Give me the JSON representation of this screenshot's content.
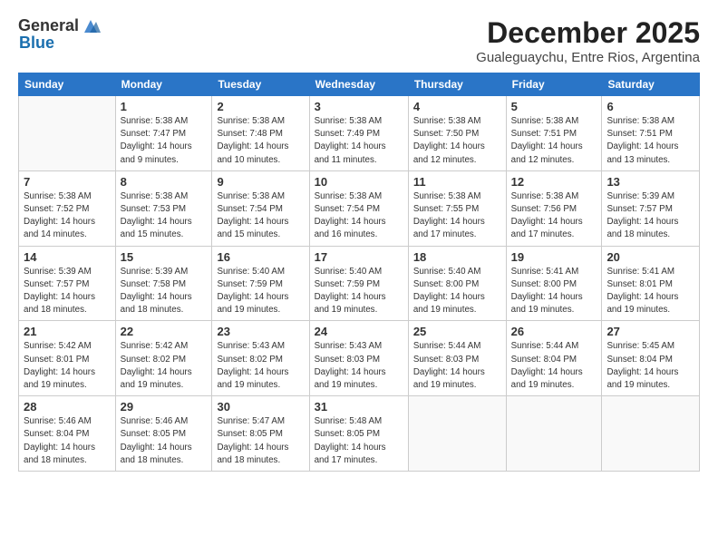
{
  "logo": {
    "general": "General",
    "blue": "Blue"
  },
  "header": {
    "title": "December 2025",
    "subtitle": "Gualeguaychu, Entre Rios, Argentina"
  },
  "weekdays": [
    "Sunday",
    "Monday",
    "Tuesday",
    "Wednesday",
    "Thursday",
    "Friday",
    "Saturday"
  ],
  "weeks": [
    [
      {
        "day": "",
        "info": ""
      },
      {
        "day": "1",
        "info": "Sunrise: 5:38 AM\nSunset: 7:47 PM\nDaylight: 14 hours\nand 9 minutes."
      },
      {
        "day": "2",
        "info": "Sunrise: 5:38 AM\nSunset: 7:48 PM\nDaylight: 14 hours\nand 10 minutes."
      },
      {
        "day": "3",
        "info": "Sunrise: 5:38 AM\nSunset: 7:49 PM\nDaylight: 14 hours\nand 11 minutes."
      },
      {
        "day": "4",
        "info": "Sunrise: 5:38 AM\nSunset: 7:50 PM\nDaylight: 14 hours\nand 12 minutes."
      },
      {
        "day": "5",
        "info": "Sunrise: 5:38 AM\nSunset: 7:51 PM\nDaylight: 14 hours\nand 12 minutes."
      },
      {
        "day": "6",
        "info": "Sunrise: 5:38 AM\nSunset: 7:51 PM\nDaylight: 14 hours\nand 13 minutes."
      }
    ],
    [
      {
        "day": "7",
        "info": "Sunrise: 5:38 AM\nSunset: 7:52 PM\nDaylight: 14 hours\nand 14 minutes."
      },
      {
        "day": "8",
        "info": "Sunrise: 5:38 AM\nSunset: 7:53 PM\nDaylight: 14 hours\nand 15 minutes."
      },
      {
        "day": "9",
        "info": "Sunrise: 5:38 AM\nSunset: 7:54 PM\nDaylight: 14 hours\nand 15 minutes."
      },
      {
        "day": "10",
        "info": "Sunrise: 5:38 AM\nSunset: 7:54 PM\nDaylight: 14 hours\nand 16 minutes."
      },
      {
        "day": "11",
        "info": "Sunrise: 5:38 AM\nSunset: 7:55 PM\nDaylight: 14 hours\nand 17 minutes."
      },
      {
        "day": "12",
        "info": "Sunrise: 5:38 AM\nSunset: 7:56 PM\nDaylight: 14 hours\nand 17 minutes."
      },
      {
        "day": "13",
        "info": "Sunrise: 5:39 AM\nSunset: 7:57 PM\nDaylight: 14 hours\nand 18 minutes."
      }
    ],
    [
      {
        "day": "14",
        "info": "Sunrise: 5:39 AM\nSunset: 7:57 PM\nDaylight: 14 hours\nand 18 minutes."
      },
      {
        "day": "15",
        "info": "Sunrise: 5:39 AM\nSunset: 7:58 PM\nDaylight: 14 hours\nand 18 minutes."
      },
      {
        "day": "16",
        "info": "Sunrise: 5:40 AM\nSunset: 7:59 PM\nDaylight: 14 hours\nand 19 minutes."
      },
      {
        "day": "17",
        "info": "Sunrise: 5:40 AM\nSunset: 7:59 PM\nDaylight: 14 hours\nand 19 minutes."
      },
      {
        "day": "18",
        "info": "Sunrise: 5:40 AM\nSunset: 8:00 PM\nDaylight: 14 hours\nand 19 minutes."
      },
      {
        "day": "19",
        "info": "Sunrise: 5:41 AM\nSunset: 8:00 PM\nDaylight: 14 hours\nand 19 minutes."
      },
      {
        "day": "20",
        "info": "Sunrise: 5:41 AM\nSunset: 8:01 PM\nDaylight: 14 hours\nand 19 minutes."
      }
    ],
    [
      {
        "day": "21",
        "info": "Sunrise: 5:42 AM\nSunset: 8:01 PM\nDaylight: 14 hours\nand 19 minutes."
      },
      {
        "day": "22",
        "info": "Sunrise: 5:42 AM\nSunset: 8:02 PM\nDaylight: 14 hours\nand 19 minutes."
      },
      {
        "day": "23",
        "info": "Sunrise: 5:43 AM\nSunset: 8:02 PM\nDaylight: 14 hours\nand 19 minutes."
      },
      {
        "day": "24",
        "info": "Sunrise: 5:43 AM\nSunset: 8:03 PM\nDaylight: 14 hours\nand 19 minutes."
      },
      {
        "day": "25",
        "info": "Sunrise: 5:44 AM\nSunset: 8:03 PM\nDaylight: 14 hours\nand 19 minutes."
      },
      {
        "day": "26",
        "info": "Sunrise: 5:44 AM\nSunset: 8:04 PM\nDaylight: 14 hours\nand 19 minutes."
      },
      {
        "day": "27",
        "info": "Sunrise: 5:45 AM\nSunset: 8:04 PM\nDaylight: 14 hours\nand 19 minutes."
      }
    ],
    [
      {
        "day": "28",
        "info": "Sunrise: 5:46 AM\nSunset: 8:04 PM\nDaylight: 14 hours\nand 18 minutes."
      },
      {
        "day": "29",
        "info": "Sunrise: 5:46 AM\nSunset: 8:05 PM\nDaylight: 14 hours\nand 18 minutes."
      },
      {
        "day": "30",
        "info": "Sunrise: 5:47 AM\nSunset: 8:05 PM\nDaylight: 14 hours\nand 18 minutes."
      },
      {
        "day": "31",
        "info": "Sunrise: 5:48 AM\nSunset: 8:05 PM\nDaylight: 14 hours\nand 17 minutes."
      },
      {
        "day": "",
        "info": ""
      },
      {
        "day": "",
        "info": ""
      },
      {
        "day": "",
        "info": ""
      }
    ]
  ]
}
